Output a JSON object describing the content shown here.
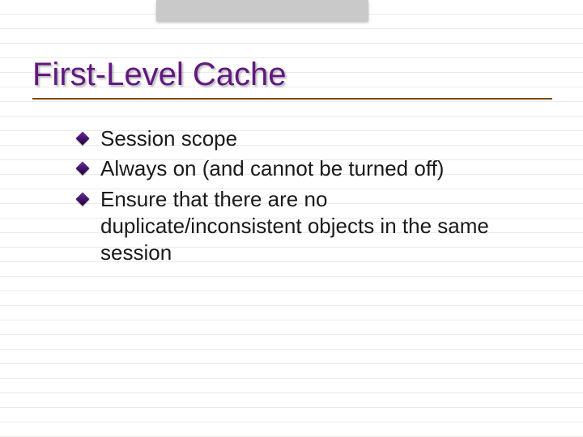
{
  "title": "First-Level Cache",
  "bullets": [
    "Session scope",
    "Always on (and cannot be turned off)",
    "Ensure that there are no duplicate/inconsistent objects in the same session"
  ]
}
